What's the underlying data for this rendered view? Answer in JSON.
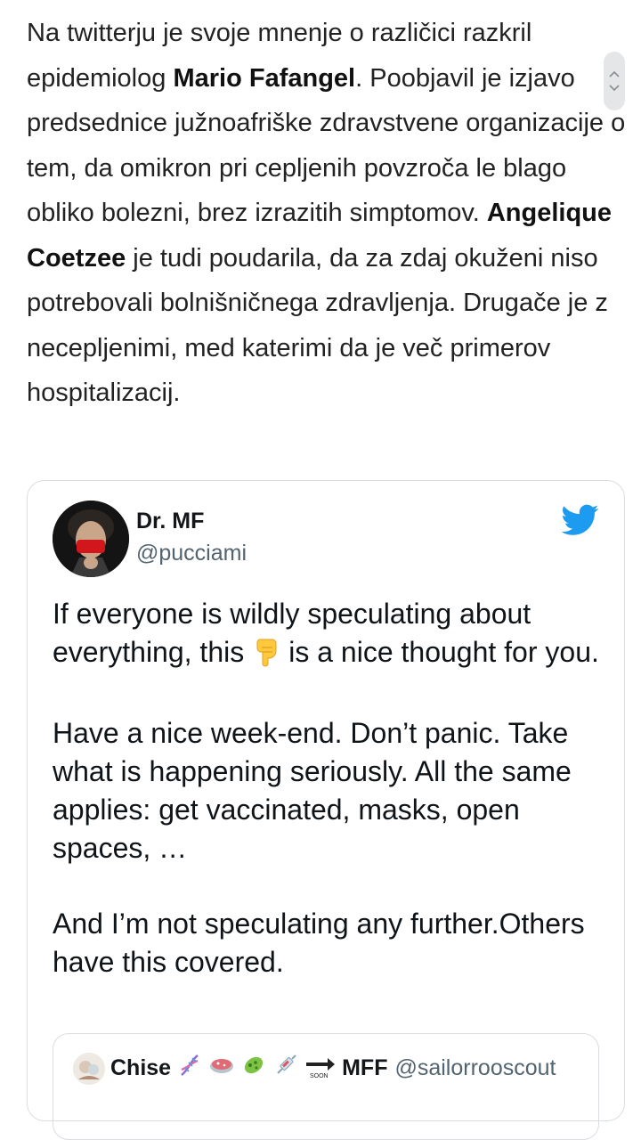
{
  "article": {
    "p1": "Na twitterju je svoje mnenje o različici razkril epidemiolog ",
    "name1": "Mario Fafangel",
    "p2": ". Poobjavil je izjavo predsednice južnoafriške zdravstvene organizacije o tem, da omikron pri cepljenih povzroča le blago obliko bolezni, brez izrazitih simptomov. ",
    "name2": "Angelique Coetzee",
    "p3": " je tudi poudarila, da za zdaj okuženi niso potrebovali bolnišničnega zdravljenja. Drugače je z necepljenimi, med katerimi da je več primerov hospitalizacij."
  },
  "tweet": {
    "author_name": "Dr. MF",
    "author_handle": "@pucciami",
    "line1_before": "If everyone is wildly speculating about everything, this",
    "line1_after": "is a nice thought for you.",
    "para2": "Have a nice week-end. Don’t panic. Take what is happening seriously. All the same applies: get vaccinated, masks, open spaces, …",
    "para3": "And I’m not speculating any further.Others have this covered.",
    "quoted": {
      "name": "Chise",
      "name_suffix": "MFF",
      "handle": "@sailorrooscout"
    }
  },
  "colors": {
    "twitter_blue": "#1d9bf0",
    "handle_gray": "#536471",
    "border": "#d9dde1"
  },
  "icons": [
    "chevron-up-icon",
    "chevron-down-icon",
    "twitter-bird-icon",
    "pointing-down-emoji",
    "dna-emoji",
    "petri-dish-emoji",
    "microbe-emoji",
    "syringe-emoji",
    "soon-arrow-emoji"
  ]
}
